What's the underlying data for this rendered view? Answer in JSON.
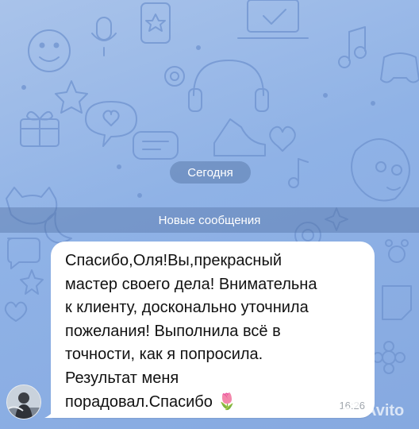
{
  "chat": {
    "date_label": "Сегодня",
    "new_messages_label": "Новые сообщения"
  },
  "message": {
    "text": "Спасибо,Оля!Вы,прекрасный\nмастер своего дела! Внимательна\nк клиенту, досконально уточнила\nпожелания! Выполнила всё в\nточности, как я попросила.\nРезультат меня\nпорадовал.Спасибо 🌷",
    "time": "16:26",
    "emoji_icon": "tulip-icon"
  },
  "watermark": {
    "text": "Avito",
    "icon": "avito-logo"
  },
  "colors": {
    "background": "#8fb2e6",
    "bubble": "#ffffff",
    "pill": "#5a7bb0"
  }
}
